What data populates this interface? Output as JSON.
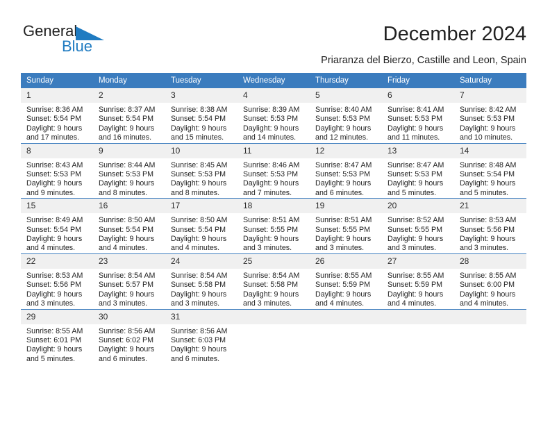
{
  "brand": {
    "name_part1": "General",
    "name_part2": "Blue",
    "triangle_color": "#1f7bc1"
  },
  "header": {
    "title": "December 2024",
    "subtitle": "Priaranza del Bierzo, Castille and Leon, Spain"
  },
  "colors": {
    "header_row_bg": "#3b7cbe",
    "daynum_bg": "#f0f0f0",
    "grid_line": "#3b7cbe"
  },
  "calendar": {
    "weekday_headers": [
      "Sunday",
      "Monday",
      "Tuesday",
      "Wednesday",
      "Thursday",
      "Friday",
      "Saturday"
    ],
    "weeks": [
      [
        {
          "day": "1",
          "sunrise": "Sunrise: 8:36 AM",
          "sunset": "Sunset: 5:54 PM",
          "daylight_line1": "Daylight: 9 hours",
          "daylight_line2": "and 17 minutes."
        },
        {
          "day": "2",
          "sunrise": "Sunrise: 8:37 AM",
          "sunset": "Sunset: 5:54 PM",
          "daylight_line1": "Daylight: 9 hours",
          "daylight_line2": "and 16 minutes."
        },
        {
          "day": "3",
          "sunrise": "Sunrise: 8:38 AM",
          "sunset": "Sunset: 5:54 PM",
          "daylight_line1": "Daylight: 9 hours",
          "daylight_line2": "and 15 minutes."
        },
        {
          "day": "4",
          "sunrise": "Sunrise: 8:39 AM",
          "sunset": "Sunset: 5:53 PM",
          "daylight_line1": "Daylight: 9 hours",
          "daylight_line2": "and 14 minutes."
        },
        {
          "day": "5",
          "sunrise": "Sunrise: 8:40 AM",
          "sunset": "Sunset: 5:53 PM",
          "daylight_line1": "Daylight: 9 hours",
          "daylight_line2": "and 12 minutes."
        },
        {
          "day": "6",
          "sunrise": "Sunrise: 8:41 AM",
          "sunset": "Sunset: 5:53 PM",
          "daylight_line1": "Daylight: 9 hours",
          "daylight_line2": "and 11 minutes."
        },
        {
          "day": "7",
          "sunrise": "Sunrise: 8:42 AM",
          "sunset": "Sunset: 5:53 PM",
          "daylight_line1": "Daylight: 9 hours",
          "daylight_line2": "and 10 minutes."
        }
      ],
      [
        {
          "day": "8",
          "sunrise": "Sunrise: 8:43 AM",
          "sunset": "Sunset: 5:53 PM",
          "daylight_line1": "Daylight: 9 hours",
          "daylight_line2": "and 9 minutes."
        },
        {
          "day": "9",
          "sunrise": "Sunrise: 8:44 AM",
          "sunset": "Sunset: 5:53 PM",
          "daylight_line1": "Daylight: 9 hours",
          "daylight_line2": "and 8 minutes."
        },
        {
          "day": "10",
          "sunrise": "Sunrise: 8:45 AM",
          "sunset": "Sunset: 5:53 PM",
          "daylight_line1": "Daylight: 9 hours",
          "daylight_line2": "and 8 minutes."
        },
        {
          "day": "11",
          "sunrise": "Sunrise: 8:46 AM",
          "sunset": "Sunset: 5:53 PM",
          "daylight_line1": "Daylight: 9 hours",
          "daylight_line2": "and 7 minutes."
        },
        {
          "day": "12",
          "sunrise": "Sunrise: 8:47 AM",
          "sunset": "Sunset: 5:53 PM",
          "daylight_line1": "Daylight: 9 hours",
          "daylight_line2": "and 6 minutes."
        },
        {
          "day": "13",
          "sunrise": "Sunrise: 8:47 AM",
          "sunset": "Sunset: 5:53 PM",
          "daylight_line1": "Daylight: 9 hours",
          "daylight_line2": "and 5 minutes."
        },
        {
          "day": "14",
          "sunrise": "Sunrise: 8:48 AM",
          "sunset": "Sunset: 5:54 PM",
          "daylight_line1": "Daylight: 9 hours",
          "daylight_line2": "and 5 minutes."
        }
      ],
      [
        {
          "day": "15",
          "sunrise": "Sunrise: 8:49 AM",
          "sunset": "Sunset: 5:54 PM",
          "daylight_line1": "Daylight: 9 hours",
          "daylight_line2": "and 4 minutes."
        },
        {
          "day": "16",
          "sunrise": "Sunrise: 8:50 AM",
          "sunset": "Sunset: 5:54 PM",
          "daylight_line1": "Daylight: 9 hours",
          "daylight_line2": "and 4 minutes."
        },
        {
          "day": "17",
          "sunrise": "Sunrise: 8:50 AM",
          "sunset": "Sunset: 5:54 PM",
          "daylight_line1": "Daylight: 9 hours",
          "daylight_line2": "and 4 minutes."
        },
        {
          "day": "18",
          "sunrise": "Sunrise: 8:51 AM",
          "sunset": "Sunset: 5:55 PM",
          "daylight_line1": "Daylight: 9 hours",
          "daylight_line2": "and 3 minutes."
        },
        {
          "day": "19",
          "sunrise": "Sunrise: 8:51 AM",
          "sunset": "Sunset: 5:55 PM",
          "daylight_line1": "Daylight: 9 hours",
          "daylight_line2": "and 3 minutes."
        },
        {
          "day": "20",
          "sunrise": "Sunrise: 8:52 AM",
          "sunset": "Sunset: 5:55 PM",
          "daylight_line1": "Daylight: 9 hours",
          "daylight_line2": "and 3 minutes."
        },
        {
          "day": "21",
          "sunrise": "Sunrise: 8:53 AM",
          "sunset": "Sunset: 5:56 PM",
          "daylight_line1": "Daylight: 9 hours",
          "daylight_line2": "and 3 minutes."
        }
      ],
      [
        {
          "day": "22",
          "sunrise": "Sunrise: 8:53 AM",
          "sunset": "Sunset: 5:56 PM",
          "daylight_line1": "Daylight: 9 hours",
          "daylight_line2": "and 3 minutes."
        },
        {
          "day": "23",
          "sunrise": "Sunrise: 8:54 AM",
          "sunset": "Sunset: 5:57 PM",
          "daylight_line1": "Daylight: 9 hours",
          "daylight_line2": "and 3 minutes."
        },
        {
          "day": "24",
          "sunrise": "Sunrise: 8:54 AM",
          "sunset": "Sunset: 5:58 PM",
          "daylight_line1": "Daylight: 9 hours",
          "daylight_line2": "and 3 minutes."
        },
        {
          "day": "25",
          "sunrise": "Sunrise: 8:54 AM",
          "sunset": "Sunset: 5:58 PM",
          "daylight_line1": "Daylight: 9 hours",
          "daylight_line2": "and 3 minutes."
        },
        {
          "day": "26",
          "sunrise": "Sunrise: 8:55 AM",
          "sunset": "Sunset: 5:59 PM",
          "daylight_line1": "Daylight: 9 hours",
          "daylight_line2": "and 4 minutes."
        },
        {
          "day": "27",
          "sunrise": "Sunrise: 8:55 AM",
          "sunset": "Sunset: 5:59 PM",
          "daylight_line1": "Daylight: 9 hours",
          "daylight_line2": "and 4 minutes."
        },
        {
          "day": "28",
          "sunrise": "Sunrise: 8:55 AM",
          "sunset": "Sunset: 6:00 PM",
          "daylight_line1": "Daylight: 9 hours",
          "daylight_line2": "and 4 minutes."
        }
      ],
      [
        {
          "day": "29",
          "sunrise": "Sunrise: 8:55 AM",
          "sunset": "Sunset: 6:01 PM",
          "daylight_line1": "Daylight: 9 hours",
          "daylight_line2": "and 5 minutes."
        },
        {
          "day": "30",
          "sunrise": "Sunrise: 8:56 AM",
          "sunset": "Sunset: 6:02 PM",
          "daylight_line1": "Daylight: 9 hours",
          "daylight_line2": "and 6 minutes."
        },
        {
          "day": "31",
          "sunrise": "Sunrise: 8:56 AM",
          "sunset": "Sunset: 6:03 PM",
          "daylight_line1": "Daylight: 9 hours",
          "daylight_line2": "and 6 minutes."
        },
        {
          "day": "",
          "sunrise": "",
          "sunset": "",
          "daylight_line1": "",
          "daylight_line2": ""
        },
        {
          "day": "",
          "sunrise": "",
          "sunset": "",
          "daylight_line1": "",
          "daylight_line2": ""
        },
        {
          "day": "",
          "sunrise": "",
          "sunset": "",
          "daylight_line1": "",
          "daylight_line2": ""
        },
        {
          "day": "",
          "sunrise": "",
          "sunset": "",
          "daylight_line1": "",
          "daylight_line2": ""
        }
      ]
    ]
  }
}
